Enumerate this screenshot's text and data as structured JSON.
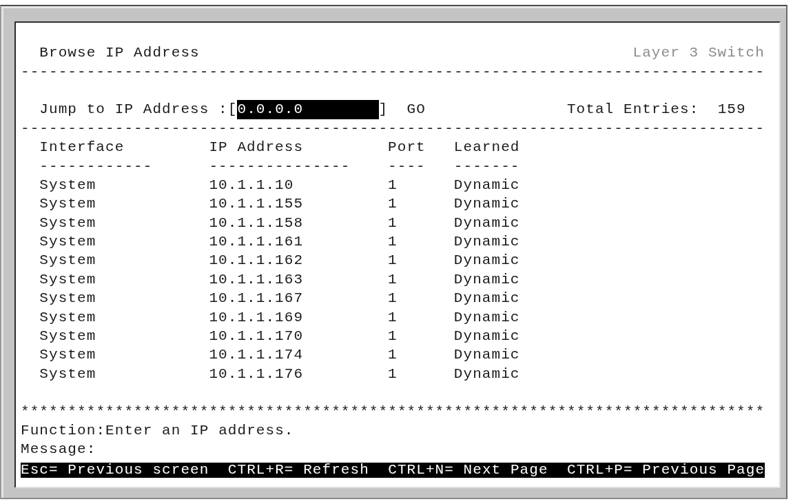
{
  "screen": {
    "title": "Browse IP Address",
    "product": "Layer 3 Switch",
    "rule_top": "-------------------------------------------------------------------------------",
    "jump": {
      "label": "Jump to IP Address :[",
      "value": "0.0.0.0",
      "bracket": "]",
      "focused": true,
      "go": "GO",
      "total_label": "Total Entries:",
      "total": "159"
    },
    "rule_mid": "-------------------------------------------------------------------------------",
    "table": {
      "columns": [
        {
          "label": "Interface",
          "underline": "------------"
        },
        {
          "label": "IP Address",
          "underline": "---------------"
        },
        {
          "label": "Port",
          "underline": "----"
        },
        {
          "label": "Learned",
          "underline": "-------"
        }
      ],
      "rows": [
        [
          "System",
          "10.1.1.10",
          "1",
          "Dynamic"
        ],
        [
          "System",
          "10.1.1.155",
          "1",
          "Dynamic"
        ],
        [
          "System",
          "10.1.1.158",
          "1",
          "Dynamic"
        ],
        [
          "System",
          "10.1.1.161",
          "1",
          "Dynamic"
        ],
        [
          "System",
          "10.1.1.162",
          "1",
          "Dynamic"
        ],
        [
          "System",
          "10.1.1.163",
          "1",
          "Dynamic"
        ],
        [
          "System",
          "10.1.1.167",
          "1",
          "Dynamic"
        ],
        [
          "System",
          "10.1.1.169",
          "1",
          "Dynamic"
        ],
        [
          "System",
          "10.1.1.170",
          "1",
          "Dynamic"
        ],
        [
          "System",
          "10.1.1.174",
          "1",
          "Dynamic"
        ],
        [
          "System",
          "10.1.1.176",
          "1",
          "Dynamic"
        ]
      ]
    },
    "rule_bottom": "*******************************************************************************",
    "function_label": "Function:",
    "function_text": "Enter an IP address.",
    "message_label": "Message:",
    "key_hints": [
      "Esc= Previous screen",
      "CTRL+R= Refresh",
      "CTRL+N= Next Page",
      "CTRL+P= Previous Page"
    ]
  }
}
